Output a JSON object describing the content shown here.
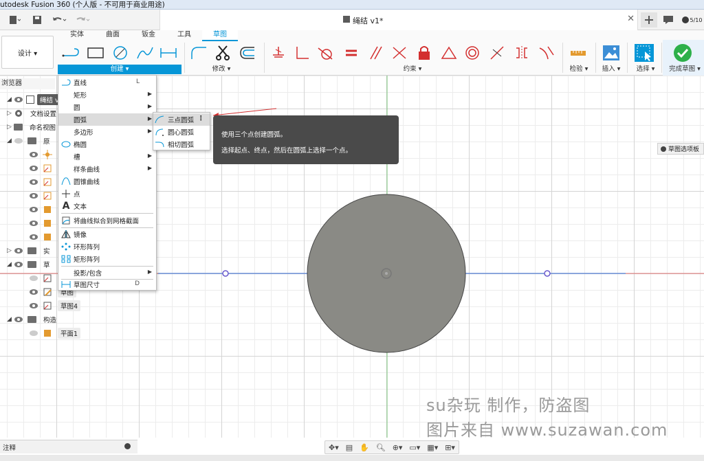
{
  "window": {
    "title": "utodesk Fusion 360 (个人版 - 不可用于商业用途)"
  },
  "document": {
    "title": "绳结 v1*",
    "job_count": "5/10"
  },
  "workspace": {
    "label": "设计 ▾"
  },
  "ribbon": {
    "tabs": [
      "实体",
      "曲面",
      "钣金",
      "工具",
      "草图"
    ],
    "active_tab": "草图",
    "groups": {
      "create": "创建 ▾",
      "modify": "修改 ▾",
      "constraints": "约束 ▾",
      "inspect": "检验 ▾",
      "insert": "插入 ▾",
      "select": "选择 ▾",
      "finish": "完成草图 ▾"
    }
  },
  "browser": {
    "title": "浏览器",
    "rows": [
      {
        "label": "绳结 v"
      },
      {
        "label": "文档设置"
      },
      {
        "label": "命名视图"
      },
      {
        "label": "原"
      },
      {
        "label": "实"
      },
      {
        "label": "草"
      },
      {
        "label": "草图"
      },
      {
        "label": "草图4"
      },
      {
        "label": "构造"
      },
      {
        "label": "平面1"
      }
    ]
  },
  "create_menu": {
    "items": [
      {
        "label": "直线",
        "shortcut": "L",
        "arrow": ""
      },
      {
        "label": "矩形",
        "shortcut": "",
        "arrow": "▶"
      },
      {
        "label": "圆",
        "shortcut": "",
        "arrow": "▶"
      },
      {
        "label": "圆弧",
        "shortcut": "",
        "arrow": "▶"
      },
      {
        "label": "多边形",
        "shortcut": "",
        "arrow": "▶"
      },
      {
        "label": "椭圆",
        "shortcut": "",
        "arrow": ""
      },
      {
        "label": "槽",
        "shortcut": "",
        "arrow": "▶"
      },
      {
        "label": "样条曲线",
        "shortcut": "",
        "arrow": "▶"
      },
      {
        "label": "圆锥曲线",
        "shortcut": "",
        "arrow": ""
      },
      {
        "label": "点",
        "shortcut": "",
        "arrow": ""
      },
      {
        "label": "文本",
        "shortcut": "",
        "arrow": ""
      },
      {
        "label": "将曲线拟合到网格截面",
        "shortcut": "",
        "arrow": ""
      },
      {
        "label": "镜像",
        "shortcut": "",
        "arrow": ""
      },
      {
        "label": "环形阵列",
        "shortcut": "",
        "arrow": ""
      },
      {
        "label": "矩形阵列",
        "shortcut": "",
        "arrow": ""
      },
      {
        "label": "投影/包含",
        "shortcut": "",
        "arrow": "▶"
      },
      {
        "label": "草图尺寸",
        "shortcut": "D",
        "arrow": ""
      }
    ]
  },
  "arc_submenu": {
    "items": [
      "三点圆弧",
      "圆心圆弧",
      "相切圆弧"
    ],
    "more": "⋮"
  },
  "tooltip": {
    "line1": "使用三个点创建圆弧。",
    "line2": "选择起点、终点，然后在圆弧上选择一个点。"
  },
  "sketch_palette": {
    "label": "草图选项板"
  },
  "comments_bar": {
    "label": "注释"
  },
  "watermark": {
    "line1": "su杂玩 制作，防盗图",
    "line2": "图片来自 www.suzawan.com"
  },
  "colors": {
    "accent": "#0696d7",
    "circle_fill": "#8a8a85",
    "axis_red": "#e07070",
    "axis_green": "#7cc47c",
    "axis_blue": "#6a8fd8"
  }
}
